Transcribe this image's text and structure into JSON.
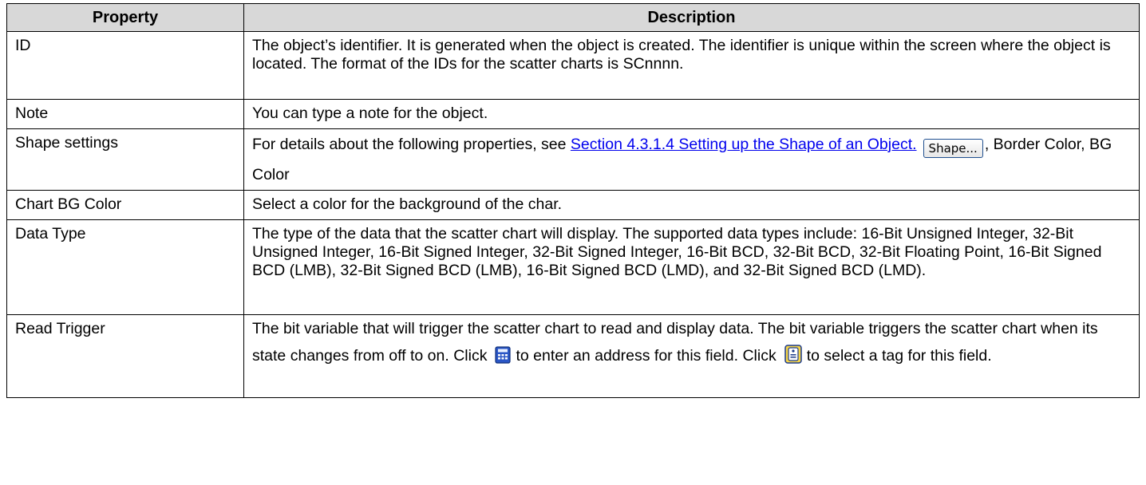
{
  "table": {
    "headers": {
      "property": "Property",
      "description": "Description"
    },
    "rows": [
      {
        "property": "ID",
        "description": "The object’s identifier. It is generated when the object is created. The identifier is unique within the screen where the object is located. The format of the IDs for the scatter charts is SCnnnn."
      },
      {
        "property": "Note",
        "description": "You can type a note for the object."
      },
      {
        "property": "Shape settings",
        "desc_prefix": "For details about the following properties, see ",
        "link_text": "Section 4.3.1.4 Setting up the Shape of an Object.",
        "button_label": "Shape...",
        "desc_suffix": ", Border Color, BG Color"
      },
      {
        "property": "Chart BG Color",
        "description": "Select a color for the background of the char."
      },
      {
        "property": "Data Type",
        "description": "The type of the data that the scatter chart will display. The supported data types include: 16-Bit Unsigned Integer, 32-Bit Unsigned Integer, 16-Bit Signed Integer, 32-Bit Signed Integer, 16-Bit BCD, 32-Bit BCD, 32-Bit Floating Point, 16-Bit Signed BCD (LMB), 32-Bit Signed BCD (LMB), 16-Bit Signed BCD (LMD), and 32-Bit Signed BCD (LMD)."
      },
      {
        "property": "Read Trigger",
        "desc_part1": "The bit variable that will trigger the scatter chart to read and display data. The bit variable triggers the scatter chart when its state changes from off to on. Click",
        "desc_part2": "to enter an address for this field. Click",
        "desc_part3": "to select a tag for this field.",
        "icons": [
          "calculator-icon",
          "tag-icon"
        ]
      }
    ]
  },
  "colors": {
    "header_bg": "#d8d8d8",
    "link": "#0000ee",
    "border": "#000000"
  }
}
